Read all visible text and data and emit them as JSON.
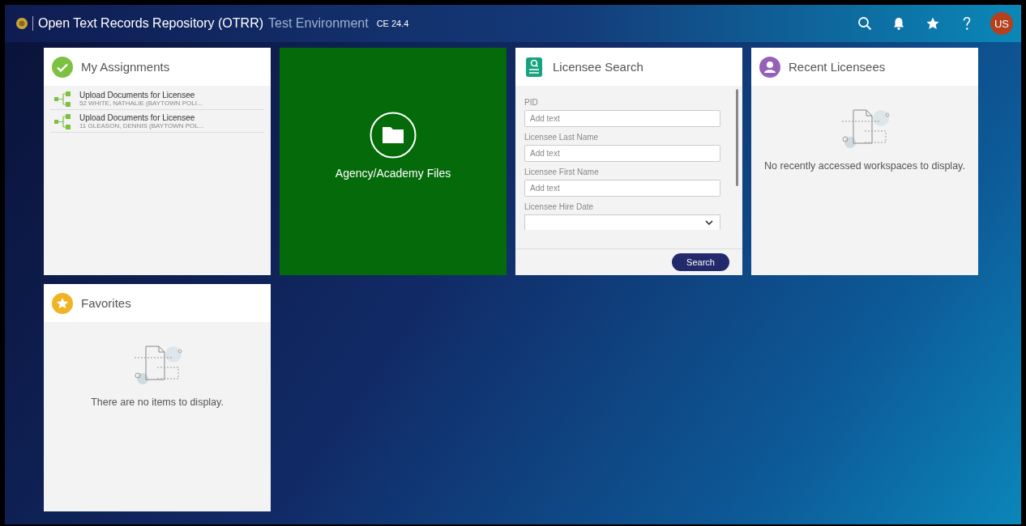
{
  "header": {
    "title": "Open Text Records Repository (OTRR)",
    "environment": "Test Environment",
    "version": "CE 24.4",
    "avatar": "US"
  },
  "tiles": [
    {
      "kind": "assignments",
      "title": "My Assignments",
      "items": [
        {
          "title": "Upload Documents for Licensee",
          "subtitle": "52 WHITE, NATHALIE (BAYTOWN POLI..."
        },
        {
          "title": "Upload Documents for Licensee",
          "subtitle": "11 GLEASON, DENNIS (BAYTOWN POL..."
        }
      ]
    },
    {
      "kind": "folder",
      "label": "Agency/Academy Files"
    },
    {
      "kind": "search",
      "title": "Licensee Search",
      "fields": [
        {
          "kind": "text",
          "label": "PID",
          "placeholder": "Add text"
        },
        {
          "kind": "text",
          "label": "Licensee Last Name",
          "placeholder": "Add text"
        },
        {
          "kind": "text",
          "label": "Licensee First Name",
          "placeholder": "Add text"
        },
        {
          "kind": "select",
          "label": "Licensee Hire Date"
        }
      ],
      "button": "Search"
    },
    {
      "kind": "recent",
      "title": "Recent Licensees",
      "message": "No recently accessed workspaces to display."
    },
    {
      "kind": "favorites",
      "title": "Favorites",
      "message": "There are no items to display."
    }
  ]
}
